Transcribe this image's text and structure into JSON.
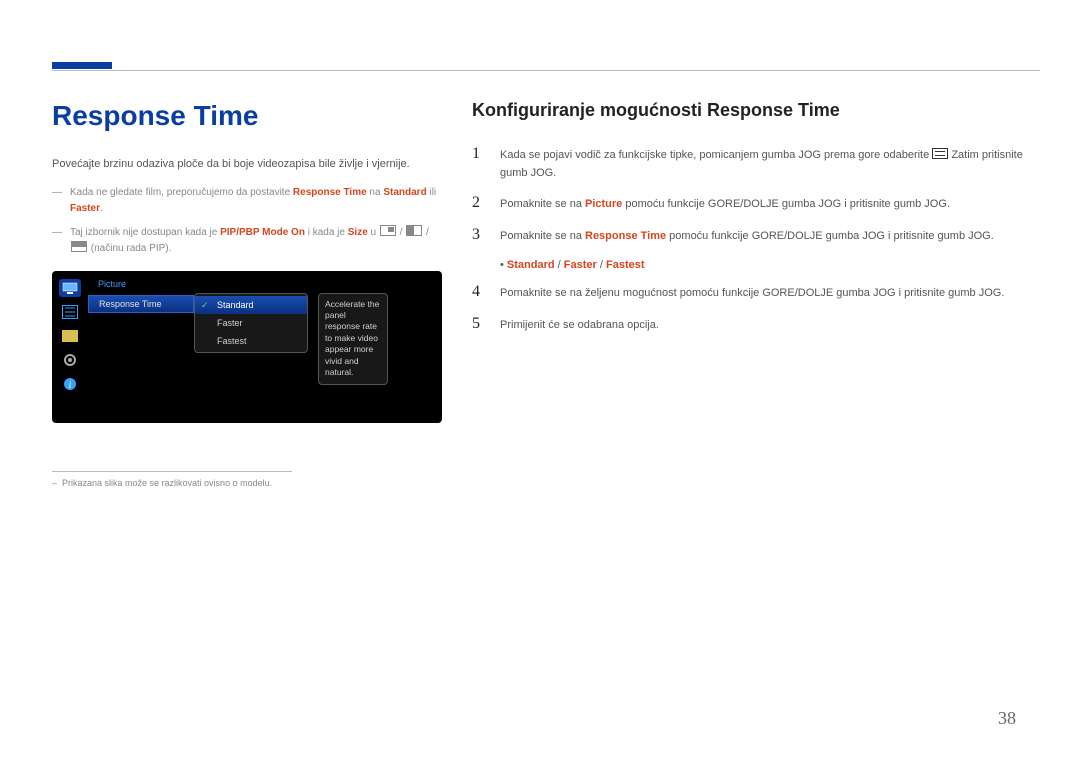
{
  "page_number": "38",
  "left": {
    "heading": "Response Time",
    "intro": "Povećajte brzinu odaziva ploče da bi boje videozapisa bile življe i vjernije.",
    "note1_pre": "Kada ne gledate film, preporučujemo da postavite ",
    "note1_rt": "Response Time",
    "note1_na": " na ",
    "note1_std": "Standard",
    "note1_ili": " ili ",
    "note1_fast": "Faster",
    "note1_end": ".",
    "note2_pre": "Taj izbornik nije dostupan kada je ",
    "note2_pip": "PIP/PBP Mode On",
    "note2_mid": " i kada je ",
    "note2_size": "Size",
    "note2_u": " u ",
    "note2_end": " (načinu rada PIP).",
    "footnote": "Prikazana slika može se razlikovati ovisno o modelu."
  },
  "osd": {
    "menu_head": "Picture",
    "menu_item": "Response Time",
    "opt1": "Standard",
    "opt2": "Faster",
    "opt3": "Fastest",
    "desc": "Accelerate the panel response rate to make video appear more vivid and natural."
  },
  "right": {
    "heading": "Konfiguriranje mogućnosti Response Time",
    "step1_pre": "Kada se pojavi vodič za funkcijske tipke, pomicanjem gumba JOG prema gore odaberite ",
    "step1_post": " Zatim pritisnite gumb JOG.",
    "step2_pre": "Pomaknite se na ",
    "step2_pic": "Picture",
    "step2_post": " pomoću funkcije GORE/DOLJE gumba JOG i pritisnite gumb JOG.",
    "step3_pre": "Pomaknite se na ",
    "step3_rt": "Response Time",
    "step3_post": " pomoću funkcije GORE/DOLJE gumba JOG i pritisnite gumb JOG.",
    "bullet_std": "Standard",
    "bullet_fast": "Faster",
    "bullet_fastest": "Fastest",
    "step4": "Pomaknite se na željenu mogućnost pomoću funkcije GORE/DOLJE gumba JOG i pritisnite gumb JOG.",
    "step5": "Primijenit će se odabrana opcija."
  }
}
